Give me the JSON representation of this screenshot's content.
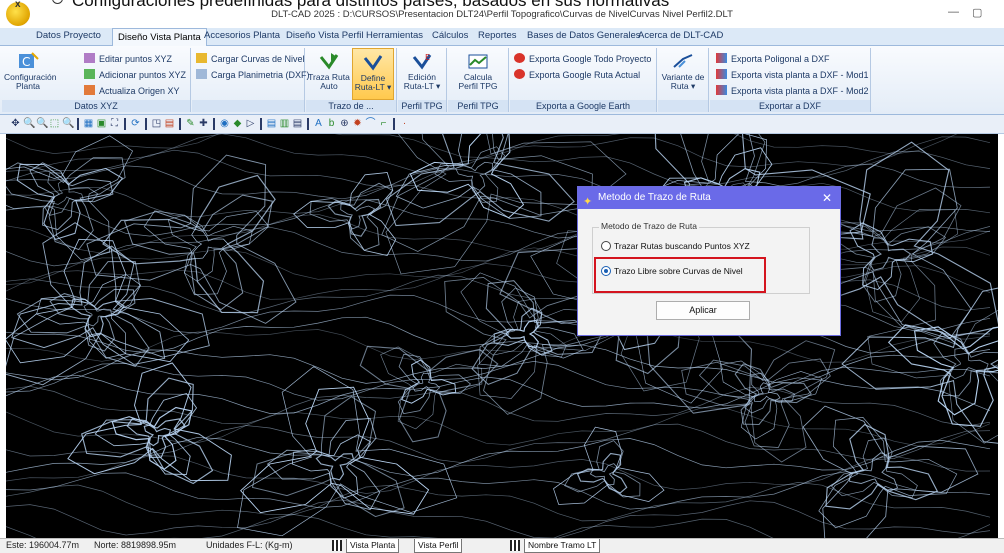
{
  "overlay": {
    "caption": "Configuraciones predefinidas para distintos países, basados en sus normativas"
  },
  "window": {
    "title": "DLT-CAD 2025 : D:\\CURSOS\\Presentacion DLT24\\Perfil Topografico\\Curvas de NivelCurvas Nivel Perfil2.DLT",
    "minimize": "—",
    "restore": "▢"
  },
  "menu_tabs": [
    "Datos Proyecto",
    "Diseño Vista Planta",
    "Accesorios Planta",
    "Diseño Vista Perfil",
    "Herramientas",
    "Cálculos",
    "Reportes",
    "Bases de Datos Generales",
    "Acerca de DLT-CAD"
  ],
  "ribbon": {
    "datos_xyz": {
      "config": "Configuración Planta",
      "editar": "Editar puntos XYZ",
      "adicionar": "Adicionar puntos XYZ",
      "actualiza": "Actualiza Origen XY",
      "label": "Datos XYZ"
    },
    "carga": {
      "curvas": "Cargar Curvas de Nivel",
      "planimetria": "Carga Planimetria (DXF)"
    },
    "trazo": {
      "traza": "Traza Ruta Auto",
      "define": "Define Ruta-LT",
      "label": "Trazo de ..."
    },
    "perfil": {
      "edicion": "Edición Ruta-LT",
      "label": "Perfil TPG"
    },
    "calcula": {
      "calcula": "Calcula Perfil TPG",
      "label": "Perfil TPG"
    },
    "google": {
      "todo": "Exporta Google Todo Proyecto",
      "ruta": "Exporta Google Ruta Actual",
      "label": "Exporta a Google Earth"
    },
    "variante": {
      "variante": "Variante de Ruta"
    },
    "dxf": {
      "poligonal": "Exporta Poligonal a DXF",
      "mod1": "Exporta vista planta a DXF - Mod1",
      "mod2": "Exporta vista planta a DXF - Mod2",
      "label": "Exportar a DXF"
    }
  },
  "dialog": {
    "title": "Metodo de Trazo de Ruta",
    "close": "✕",
    "group_label": "Metodo de Trazo de Ruta",
    "option1": "Trazar Rutas buscando Puntos XYZ",
    "option2": "Trazo Libre sobre Curvas de Nivel",
    "selected": "option2",
    "apply": "Aplicar"
  },
  "status": {
    "este": "Este: 196004.77m",
    "norte": "Norte: 8819898.95m",
    "unidades": "Unidades F-L: (Kg-m)",
    "tab_planta": "Vista Planta",
    "tab_perfil": "Vista Perfil",
    "tab_tramo": "Nombre Tramo LT"
  },
  "colors": {
    "accent": "#6a6ae8",
    "contour": "#b9d4f2",
    "highlight": "#d4141e"
  }
}
